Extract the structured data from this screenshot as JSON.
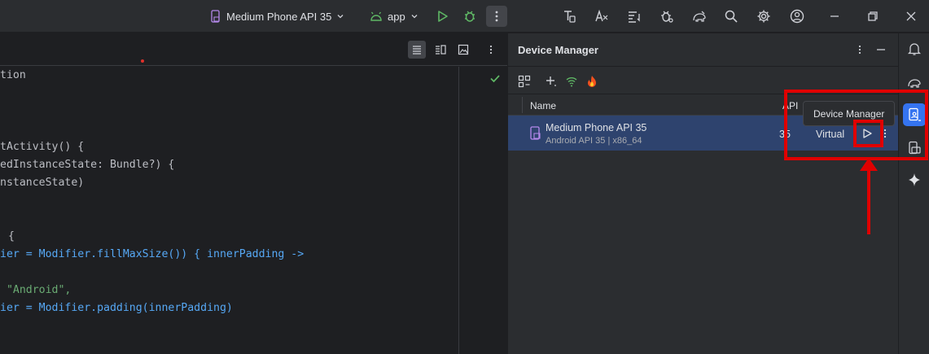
{
  "toolbar": {
    "device_label": "Medium Phone API 35",
    "app_label": "app"
  },
  "editor": {
    "code_lines": [
      "tion",
      "tActivity() {",
      "edInstanceState: Bundle?) {",
      "nstanceState)",
      "{",
      "ier = Modifier.fillMaxSize()) { innerPadding ->",
      " \"Android\",",
      "ier = Modifier.padding(innerPadding)"
    ]
  },
  "device_manager": {
    "title": "Device Manager",
    "columns": {
      "name": "Name",
      "api": "API"
    },
    "rows": [
      {
        "name": "Medium Phone API 35",
        "subtitle": "Android API 35 | x86_64",
        "api": "35",
        "type": "Virtual"
      }
    ]
  },
  "tooltip": {
    "text": "Device Manager"
  },
  "colors": {
    "accent": "#3574f0",
    "selection": "#2e436e",
    "annotation": "#e00000"
  }
}
